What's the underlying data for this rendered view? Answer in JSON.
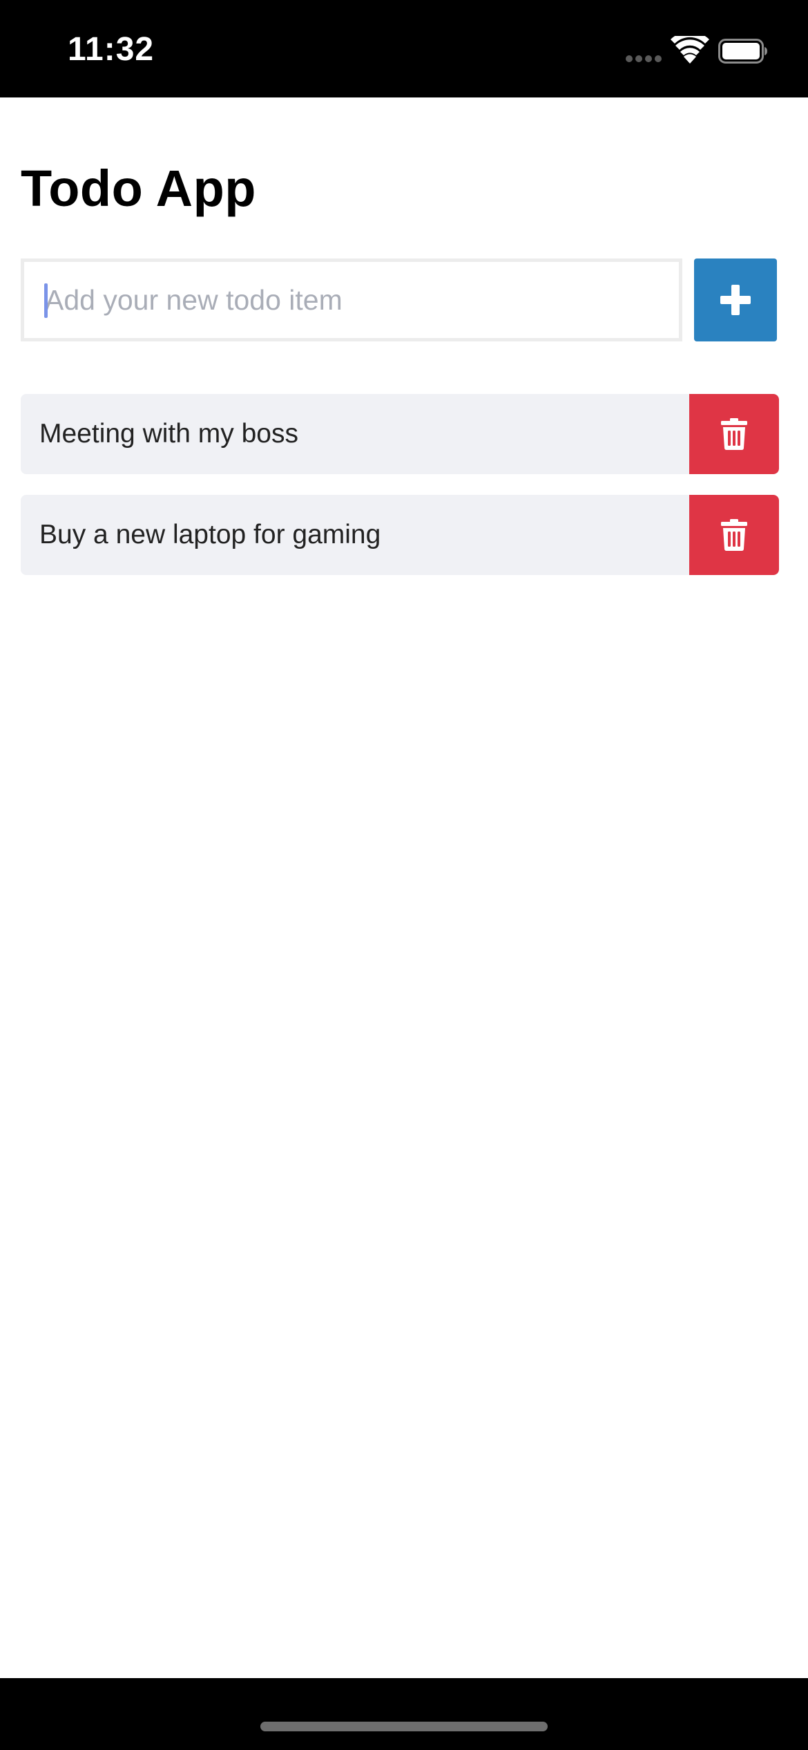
{
  "status_bar": {
    "time": "11:32",
    "icons": [
      "cellular-signal-icon",
      "wifi-icon",
      "battery-icon"
    ]
  },
  "app": {
    "title": "Todo App"
  },
  "new_todo": {
    "value": "",
    "placeholder": "Add your new todo item",
    "add_icon": "plus-icon"
  },
  "todos": [
    {
      "text": "Meeting with my boss",
      "delete_icon": "trash-icon"
    },
    {
      "text": "Buy a new laptop for gaming",
      "delete_icon": "trash-icon"
    }
  ],
  "colors": {
    "add_button": "#2a82c0",
    "delete_button": "#df3545",
    "item_background": "#f0f1f5",
    "input_border": "#ececec",
    "placeholder": "#a9adb7"
  }
}
